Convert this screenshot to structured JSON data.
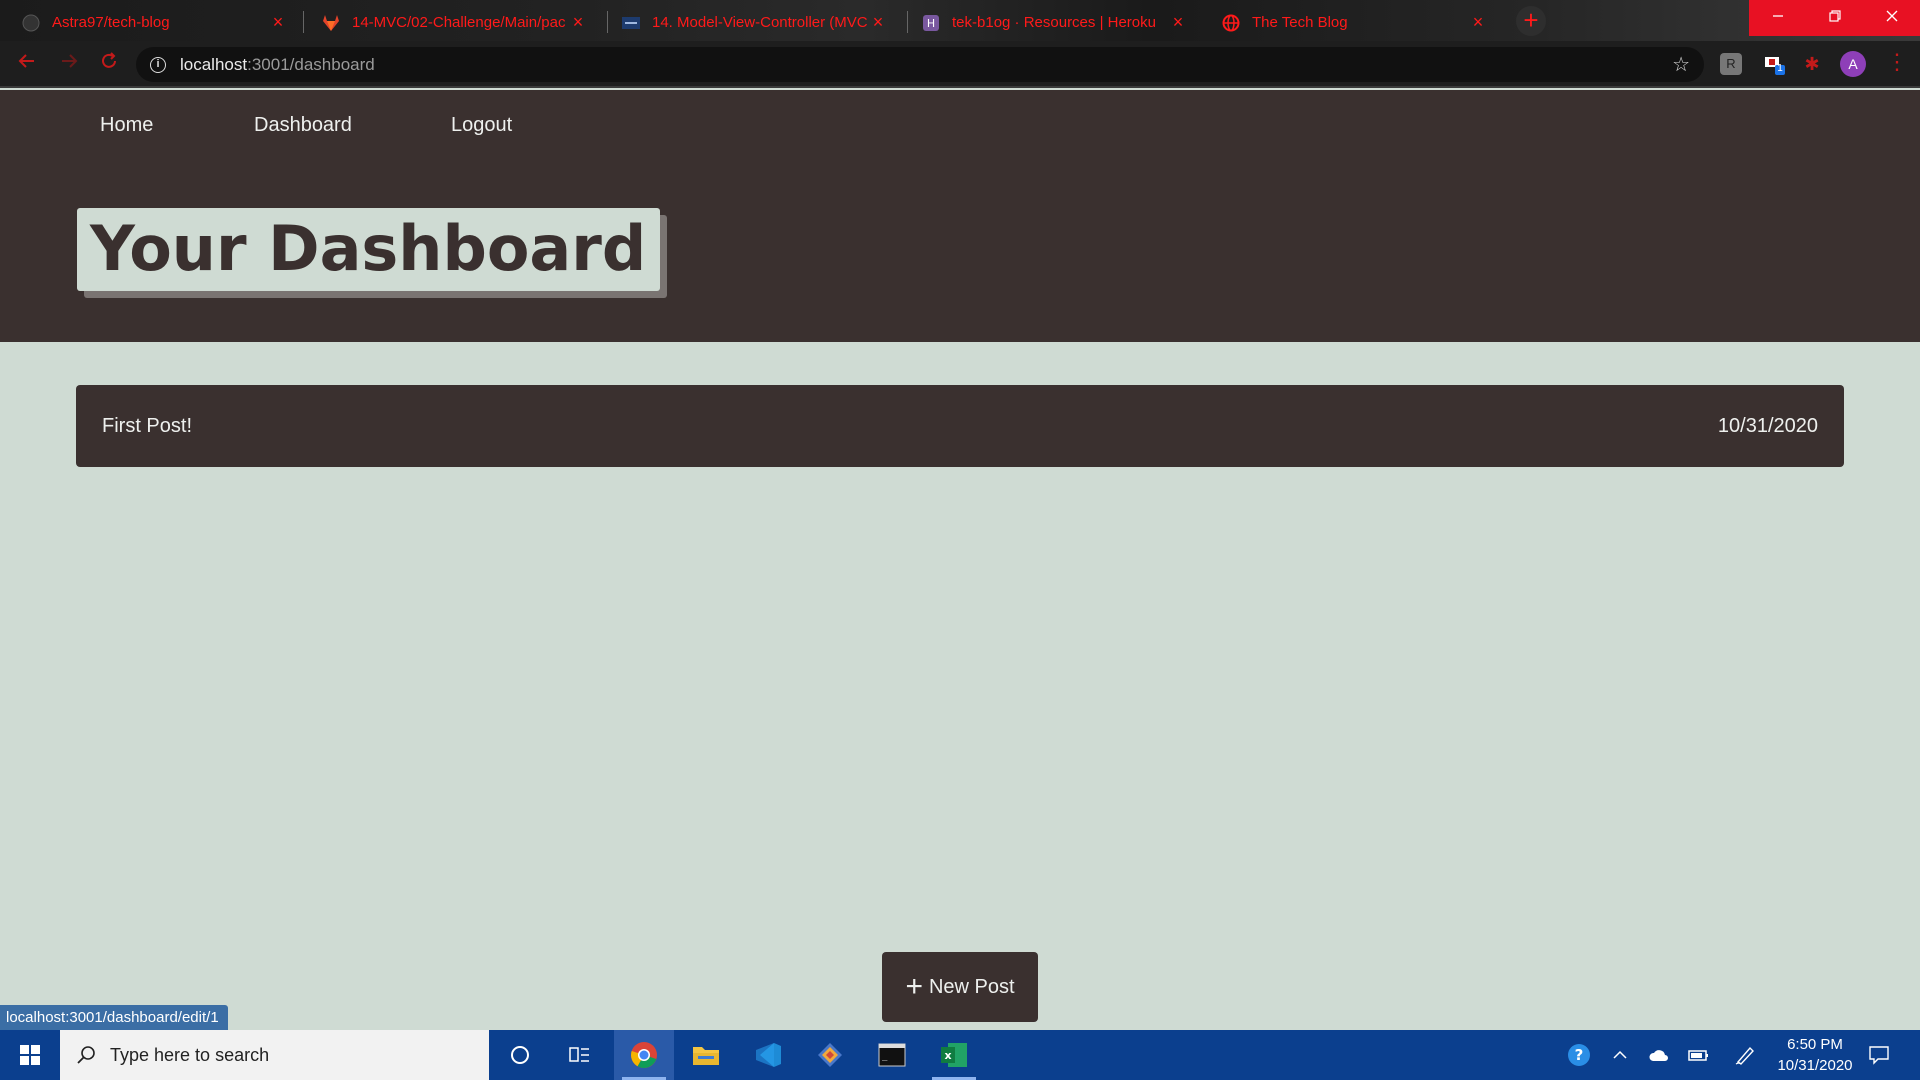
{
  "browser": {
    "tabs": [
      {
        "title": "Astra97/tech-blog",
        "favicon": "github-icon"
      },
      {
        "title": "14-MVC/02-Challenge/Main/pac",
        "favicon": "gitlab-icon"
      },
      {
        "title": "14. Model-View-Controller (MVC",
        "favicon": "bootcamp-icon"
      },
      {
        "title": "tek-b1og · Resources | Heroku",
        "favicon": "heroku-icon"
      },
      {
        "title": "The Tech Blog",
        "favicon": "globe-icon"
      }
    ],
    "close_glyph": "×",
    "new_tab_glyph": "+",
    "url_host": "localhost",
    "url_path": ":3001/dashboard",
    "profile_initial": "A",
    "extension_badge": "1",
    "accent_color": "#ff1a1a"
  },
  "nav": {
    "home": "Home",
    "dashboard": "Dashboard",
    "logout": "Logout"
  },
  "page": {
    "title": "Your Dashboard",
    "posts": [
      {
        "title": "First Post!",
        "date": "10/31/2020"
      }
    ],
    "new_post_plus": "+",
    "new_post_label": "New Post",
    "status_bar_url": "localhost:3001/dashboard/edit/1",
    "colors": {
      "header_bg": "#3a302f",
      "page_bg": "#cfdbd3"
    }
  },
  "taskbar": {
    "search_placeholder": "Type here to search",
    "time": "6:50 PM",
    "date": "10/31/2020"
  }
}
